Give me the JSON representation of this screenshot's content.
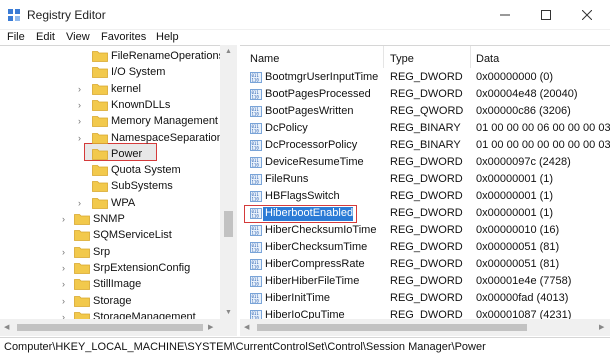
{
  "window": {
    "title": "Registry Editor"
  },
  "menu": [
    "File",
    "Edit",
    "View",
    "Favorites",
    "Help"
  ],
  "tree": [
    {
      "label": "FileRenameOperations",
      "expandable": false
    },
    {
      "label": "I/O System",
      "expandable": false
    },
    {
      "label": "kernel",
      "expandable": true
    },
    {
      "label": "KnownDLLs",
      "expandable": true
    },
    {
      "label": "Memory Management",
      "expandable": true
    },
    {
      "label": "NamespaceSeparation",
      "expandable": true
    },
    {
      "label": "Power",
      "expandable": false,
      "selected": true
    },
    {
      "label": "Quota System",
      "expandable": false
    },
    {
      "label": "SubSystems",
      "expandable": false
    },
    {
      "label": "WPA",
      "expandable": true
    },
    {
      "label": "SNMP",
      "expandable": true
    },
    {
      "label": "SQMServiceList",
      "expandable": false
    },
    {
      "label": "Srp",
      "expandable": true
    },
    {
      "label": "SrpExtensionConfig",
      "expandable": true
    },
    {
      "label": "StillImage",
      "expandable": true
    },
    {
      "label": "Storage",
      "expandable": true
    },
    {
      "label": "StorageManagement",
      "expandable": true
    }
  ],
  "columns": {
    "name": "Name",
    "type": "Type",
    "data": "Data"
  },
  "rows": [
    {
      "name": "BootmgrUserInputTime",
      "type": "REG_DWORD",
      "data": "0x00000000 (0)"
    },
    {
      "name": "BootPagesProcessed",
      "type": "REG_DWORD",
      "data": "0x00004e48 (20040)"
    },
    {
      "name": "BootPagesWritten",
      "type": "REG_QWORD",
      "data": "0x00000c86 (3206)"
    },
    {
      "name": "DcPolicy",
      "type": "REG_BINARY",
      "data": "01 00 00 00 06 00 00 00 03"
    },
    {
      "name": "DcProcessorPolicy",
      "type": "REG_BINARY",
      "data": "01 00 00 00 00 00 00 00 03"
    },
    {
      "name": "DeviceResumeTime",
      "type": "REG_DWORD",
      "data": "0x0000097c (2428)"
    },
    {
      "name": "FileRuns",
      "type": "REG_DWORD",
      "data": "0x00000001 (1)"
    },
    {
      "name": "HBFlagsSwitch",
      "type": "REG_DWORD",
      "data": "0x00000001 (1)"
    },
    {
      "name": "HiberbootEnabled",
      "type": "REG_DWORD",
      "data": "0x00000001 (1)",
      "selected": true
    },
    {
      "name": "HiberChecksumIoTime",
      "type": "REG_DWORD",
      "data": "0x00000010 (16)"
    },
    {
      "name": "HiberChecksumTime",
      "type": "REG_DWORD",
      "data": "0x00000051 (81)"
    },
    {
      "name": "HiberCompressRate",
      "type": "REG_DWORD",
      "data": "0x00000051 (81)"
    },
    {
      "name": "HiberHiberFileTime",
      "type": "REG_DWORD",
      "data": "0x00001e4e (7758)"
    },
    {
      "name": "HiberInitTime",
      "type": "REG_DWORD",
      "data": "0x00000fad (4013)"
    },
    {
      "name": "HiberIoCpuTime",
      "type": "REG_DWORD",
      "data": "0x00001087 (4231)"
    }
  ],
  "status": {
    "path": "Computer\\HKEY_LOCAL_MACHINE\\SYSTEM\\CurrentControlSet\\Control\\Session Manager\\Power"
  },
  "colors": {
    "selection": "#2b7bd6",
    "highlight_box": "#d43a3a",
    "folder": "#f2c94c"
  }
}
